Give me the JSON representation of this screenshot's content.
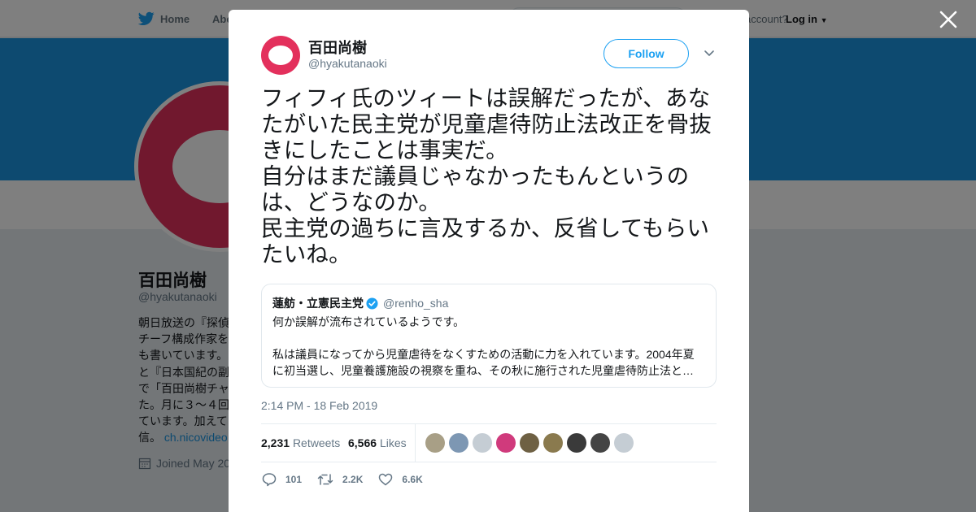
{
  "colors": {
    "brand_blue": "#1da1f2",
    "banner_blue": "#1b95e0",
    "avatar_red": "#e3305c",
    "text": "#14171a",
    "muted": "#657786"
  },
  "nav": {
    "home_label": "Home",
    "about_label": "Abo",
    "account_prompt": "account?",
    "login_label": "Log in",
    "home_icon": "twitter-bird-icon"
  },
  "profile": {
    "name": "百田尚樹",
    "handle": "@hyakutanaoki",
    "bio_text": "朝日放送の『探偵\nチーフ構成作家を\nも書いています。\nと『日本国紀の副\nで「百田尚樹チャ\nた。月に３～４回\nています。加えて\n信。 ",
    "bio_link": "ch.nicovideo",
    "joined": "Joined May 20"
  },
  "modal": {
    "close_icon": "close-icon",
    "author_name": "百田尚樹",
    "author_handle": "@hyakutanaoki",
    "follow_label": "Follow",
    "tweet_text": "フィフィ氏のツィートは誤解だったが、あなたがいた民主党が児童虐待防止法改正を骨抜きにしたことは事実だ。\n自分はまだ議員じゃなかったもんというのは、どうなのか。\n民主党の過ちに言及するか、反省してもらいたいね。",
    "quote": {
      "name": "蓮舫・立憲民主党",
      "handle": "@renho_sha",
      "line1": "何か誤解が流布されているようです。",
      "line2": "私は議員になってから児童虐待をなくすための活動に力を入れています。2004年夏",
      "line3": "に初当選し、児童養護施設の視察を重ね、その秋に施行された児童虐待防止法と…"
    },
    "timestamp": "2:14 PM - 18 Feb 2019",
    "retweets_count": "2,231",
    "retweets_label": "Retweets",
    "likes_count": "6,566",
    "likes_label": "Likes",
    "liker_colors": [
      "#a89f86",
      "#7d97b3",
      "#c5cdd4",
      "#d03a7c",
      "#6e6043",
      "#8a7a4e",
      "#3a3a3a",
      "#444444",
      "#c5cdd4"
    ],
    "actions": {
      "reply_count": "101",
      "retweet_count": "2.2K",
      "like_count": "6.6K"
    }
  }
}
